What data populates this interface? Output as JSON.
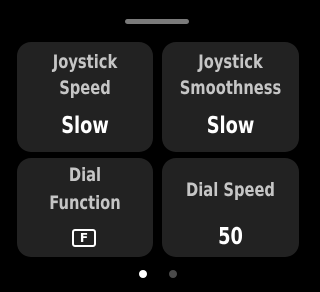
{
  "tiles": {
    "joystick_speed": {
      "label_line1": "Joystick",
      "label_line2": "Speed",
      "value": "Slow"
    },
    "joystick_smoothness": {
      "label_line1": "Joystick",
      "label_line2": "Smoothness",
      "value": "Slow"
    },
    "dial_function": {
      "label_line1": "Dial",
      "label_line2": "Function",
      "value_icon_text": "F"
    },
    "dial_speed": {
      "label": "Dial Speed",
      "value": "50"
    }
  },
  "pager": {
    "total_pages": 2,
    "active_page": 1
  },
  "colors": {
    "background": "#000000",
    "tile": "#222222",
    "label": "#c6c6c6",
    "value": "#ffffff",
    "dot_active": "#ffffff",
    "dot_inactive": "#4a4a4a"
  }
}
